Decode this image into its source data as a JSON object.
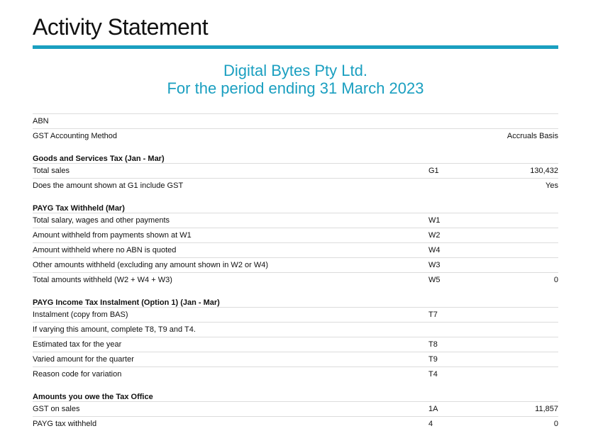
{
  "header": {
    "title": "Activity Statement",
    "company": "Digital Bytes Pty Ltd.",
    "period": "For the period ending 31 March 2023"
  },
  "accent_color": "#1a9fc0",
  "blocks": [
    {
      "type": "row",
      "label": "ABN",
      "code": "",
      "value": ""
    },
    {
      "type": "row",
      "label": "GST Accounting Method",
      "code": "",
      "value": "Accruals Basis"
    },
    {
      "type": "section",
      "label": "Goods and Services Tax (Jan - Mar)"
    },
    {
      "type": "row",
      "label": "Total sales",
      "code": "G1",
      "value": "130,432"
    },
    {
      "type": "row",
      "label": "Does the amount shown at G1 include GST",
      "code": "",
      "value": "Yes"
    },
    {
      "type": "section",
      "label": "PAYG Tax Withheld (Mar)"
    },
    {
      "type": "row",
      "label": "Total salary, wages and other payments",
      "code": "W1",
      "value": ""
    },
    {
      "type": "row",
      "label": "Amount withheld from payments shown at W1",
      "code": "W2",
      "value": ""
    },
    {
      "type": "row",
      "label": "Amount withheld where no ABN is quoted",
      "code": "W4",
      "value": ""
    },
    {
      "type": "row",
      "label": "Other amounts withheld (excluding any amount shown in W2 or W4)",
      "code": "W3",
      "value": ""
    },
    {
      "type": "row",
      "label": "Total amounts withheld (W2 + W4 + W3)",
      "code": "W5",
      "value": "0"
    },
    {
      "type": "section",
      "label": "PAYG Income Tax Instalment (Option 1) (Jan - Mar)"
    },
    {
      "type": "row",
      "label": "Instalment (copy from BAS)",
      "code": "T7",
      "value": ""
    },
    {
      "type": "row",
      "label": "If varying this amount, complete T8, T9 and T4.",
      "code": "",
      "value": ""
    },
    {
      "type": "row",
      "label": "Estimated tax for the year",
      "code": "T8",
      "value": ""
    },
    {
      "type": "row",
      "label": "Varied amount for the quarter",
      "code": "T9",
      "value": ""
    },
    {
      "type": "row",
      "label": "Reason code for variation",
      "code": "T4",
      "value": ""
    },
    {
      "type": "section",
      "label": "Amounts you owe the Tax Office"
    },
    {
      "type": "row",
      "label": "GST on sales",
      "code": "1A",
      "value": "11,857"
    },
    {
      "type": "row",
      "label": "PAYG tax withheld",
      "code": "4",
      "value": "0"
    }
  ]
}
